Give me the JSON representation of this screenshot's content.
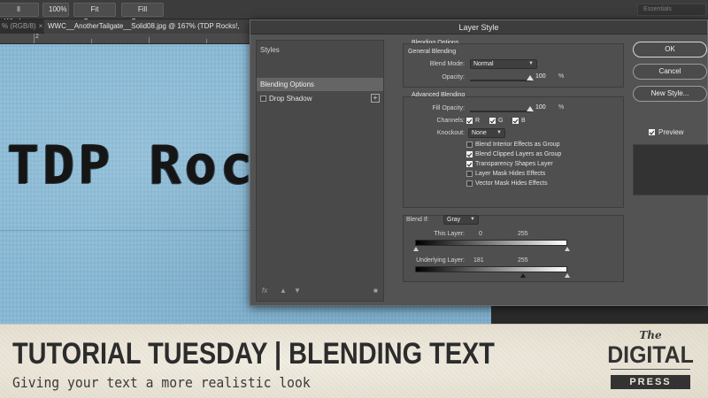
{
  "options_bar": {
    "buttons": [
      {
        "label": "ll Windows"
      },
      {
        "label": "100%"
      },
      {
        "label": "Fit Screen"
      },
      {
        "label": "Fill Screen"
      }
    ],
    "workspace": "Essentials"
  },
  "tabs": [
    {
      "label": "% (RGB/8)"
    },
    {
      "label": "WWC__AnotherTailgate__Solid08.jpg @ 167% (TDP Rocks!,"
    }
  ],
  "ruler": {
    "labels": [
      "2",
      "3"
    ]
  },
  "canvas": {
    "text": "TDP Rocks!"
  },
  "dialog": {
    "title": "Layer Style",
    "left_pane": {
      "styles_label": "Styles",
      "blending_options": "Blending Options",
      "drop_shadow": "Drop Shadow",
      "fx_label": "fx"
    },
    "blending": {
      "section_title": "Blending Options",
      "general_title": "General Blending",
      "blend_mode_label": "Blend Mode:",
      "blend_mode_value": "Normal",
      "opacity_label": "Opacity:",
      "opacity_value": "100",
      "opacity_unit": "%",
      "opacity_fraction": 1.0,
      "advanced_title": "Advanced Blending",
      "fill_opacity_label": "Fill Opacity:",
      "fill_opacity_value": "100",
      "fill_opacity_unit": "%",
      "fill_opacity_fraction": 1.0,
      "channels_label": "Channels:",
      "channels": [
        {
          "label": "R",
          "checked": true
        },
        {
          "label": "G",
          "checked": true
        },
        {
          "label": "B",
          "checked": true
        }
      ],
      "knockout_label": "Knockout:",
      "knockout_value": "None",
      "options": [
        {
          "label": "Blend Interior Effects as Group",
          "checked": false
        },
        {
          "label": "Blend Clipped Layers as Group",
          "checked": true
        },
        {
          "label": "Transparency Shapes Layer",
          "checked": true
        },
        {
          "label": "Layer Mask Hides Effects",
          "checked": false
        },
        {
          "label": "Vector Mask Hides Effects",
          "checked": false
        }
      ],
      "blend_if_label": "Blend If:",
      "blend_if_value": "Gray",
      "this_layer_label": "This Layer:",
      "this_layer_min": "0",
      "this_layer_max": "255",
      "underlying_label": "Underlying Layer:",
      "underlying_min": "181",
      "underlying_max": "255"
    },
    "buttons": {
      "ok": "OK",
      "cancel": "Cancel",
      "new_style": "New Style...",
      "preview_label": "Preview",
      "preview_checked": true
    }
  },
  "banner": {
    "title": "TUTORIAL TUESDAY  |  BLENDING TEXT",
    "subtitle": "Giving your text a more realistic look",
    "logo_the": "The",
    "logo_digital": "DIGITAL",
    "logo_press": "PRESS"
  },
  "colors": {
    "canvas_blue": "#86b8d5",
    "dialog_bg": "#535353",
    "banner_bg": "#ece7da"
  }
}
